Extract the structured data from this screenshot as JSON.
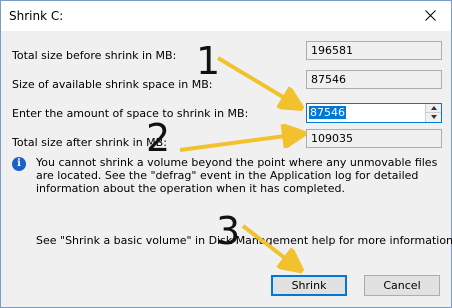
{
  "window": {
    "title": "Shrink C:"
  },
  "fields": {
    "total_size_label": "Total size before shrink in MB:",
    "total_size_value": "196581",
    "available_label": "Size of available shrink space in MB:",
    "available_value": "87546",
    "amount_label": "Enter the amount of space to shrink in MB:",
    "amount_value": "87546",
    "after_label": "Total size after shrink in MB:",
    "after_value": "109035"
  },
  "info": {
    "icon": "info-icon",
    "message": "You cannot shrink a volume beyond the point where any unmovable files are located. See the \"defrag\" event in the Application log for detailed information about the operation when it has completed."
  },
  "help_text": "See \"Shrink a basic volume\" in Disk Management help for more information",
  "buttons": {
    "shrink": "Shrink",
    "cancel": "Cancel"
  },
  "annotations": {
    "step1": "1",
    "step2": "2",
    "step3": "3",
    "arrow_color": "#f2c12e"
  }
}
